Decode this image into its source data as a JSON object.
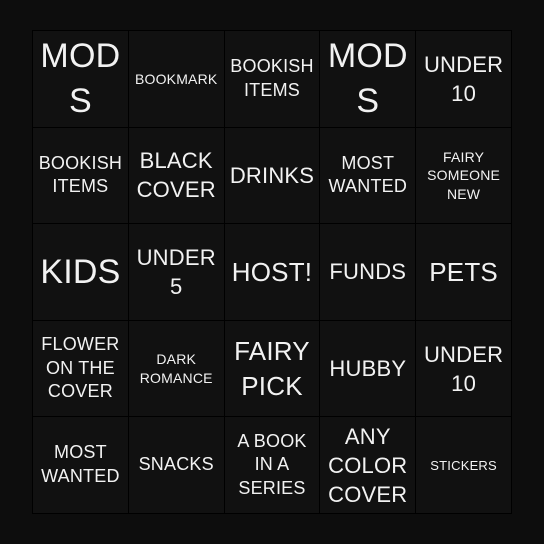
{
  "card": {
    "background_color": "#0d0d0d",
    "cell_color": "#111111",
    "grid_line_color": "#000000",
    "text_color": "#f2f2f2",
    "columns": 5,
    "rows": 5,
    "cells": [
      {
        "text": "MODS",
        "size": "xl"
      },
      {
        "text": "BOOKMARK",
        "size": "xs"
      },
      {
        "text": "BOOKISH ITEMS",
        "size": "sm"
      },
      {
        "text": "MODS",
        "size": "xl"
      },
      {
        "text": "UNDER 10",
        "size": "md"
      },
      {
        "text": "BOOKISH ITEMS",
        "size": "sm"
      },
      {
        "text": "BLACK COVER",
        "size": "md"
      },
      {
        "text": "DRINKS",
        "size": "md"
      },
      {
        "text": "MOST WANTED",
        "size": "sm"
      },
      {
        "text": "FAIRY SOMEONE NEW",
        "size": "xs"
      },
      {
        "text": "KIDS",
        "size": "xl"
      },
      {
        "text": "UNDER 5",
        "size": "md"
      },
      {
        "text": "HOST!",
        "size": "lg"
      },
      {
        "text": "FUNDS",
        "size": "md"
      },
      {
        "text": "PETS",
        "size": "lg"
      },
      {
        "text": "FLOWER ON THE COVER",
        "size": "sm"
      },
      {
        "text": "DARK ROMANCE",
        "size": "xs"
      },
      {
        "text": "FAIRY PICK",
        "size": "lg"
      },
      {
        "text": "HUBBY",
        "size": "md"
      },
      {
        "text": "UNDER 10",
        "size": "md"
      },
      {
        "text": "MOST WANTED",
        "size": "sm"
      },
      {
        "text": "SNACKS",
        "size": "sm"
      },
      {
        "text": "A BOOK IN A SERIES",
        "size": "sm"
      },
      {
        "text": "ANY COLOR COVER",
        "size": "md"
      },
      {
        "text": "STICKERS",
        "size": "xxs"
      }
    ]
  }
}
